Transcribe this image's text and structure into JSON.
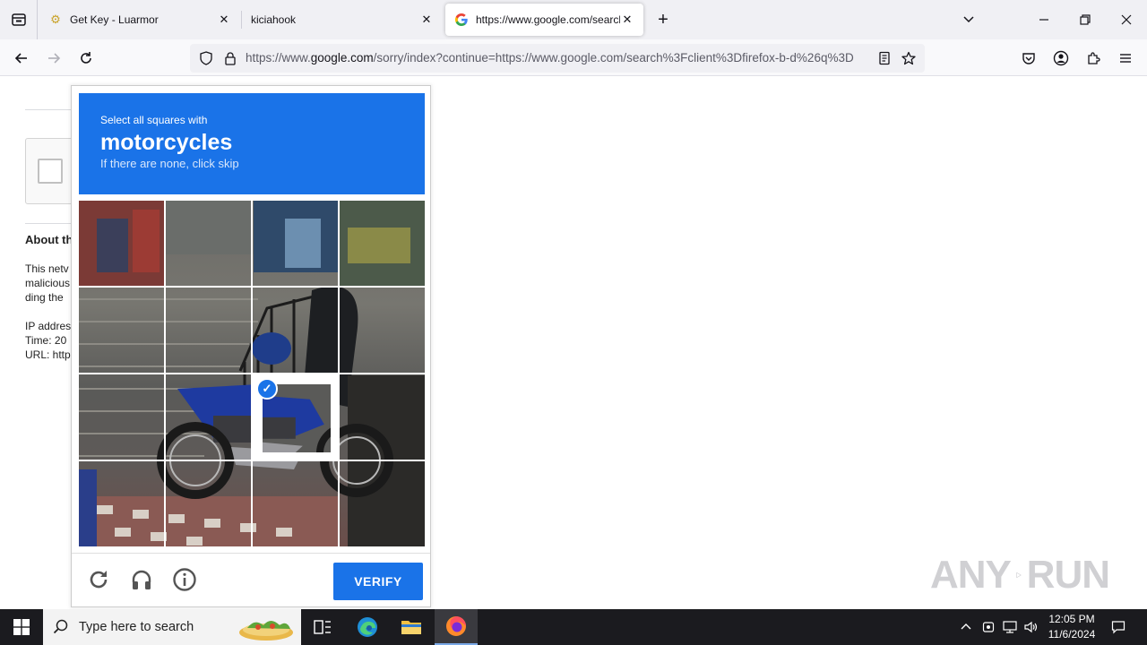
{
  "browser": {
    "tabs": [
      {
        "label": "Get Key - Luarmor",
        "active": false
      },
      {
        "label": "kiciahook",
        "active": false
      },
      {
        "label": "https://www.google.com/search",
        "active": true
      }
    ],
    "url": {
      "prefix": "https://www.",
      "host": "google.com",
      "rest": "/sorry/index?continue=https://www.google.com/search%3Fclient%3Dfirefox-b-d%26q%3D"
    }
  },
  "page": {
    "heading": "About th",
    "lines": [
      "This netv",
      "malicious",
      "ding the"
    ],
    "info": [
      "IP addres",
      "Time: 20",
      "URL: http"
    ]
  },
  "captcha": {
    "instruction": "Select all squares with",
    "keyword": "motorcycles",
    "hint": "If there are none, click skip",
    "verify_label": "VERIFY",
    "selected_tiles": [
      10
    ],
    "colors": {
      "accent": "#1a73e8"
    }
  },
  "watermark": {
    "left": "ANY",
    "right": "RUN"
  },
  "taskbar": {
    "search_placeholder": "Type here to search",
    "time": "12:05 PM",
    "date": "11/6/2024"
  }
}
